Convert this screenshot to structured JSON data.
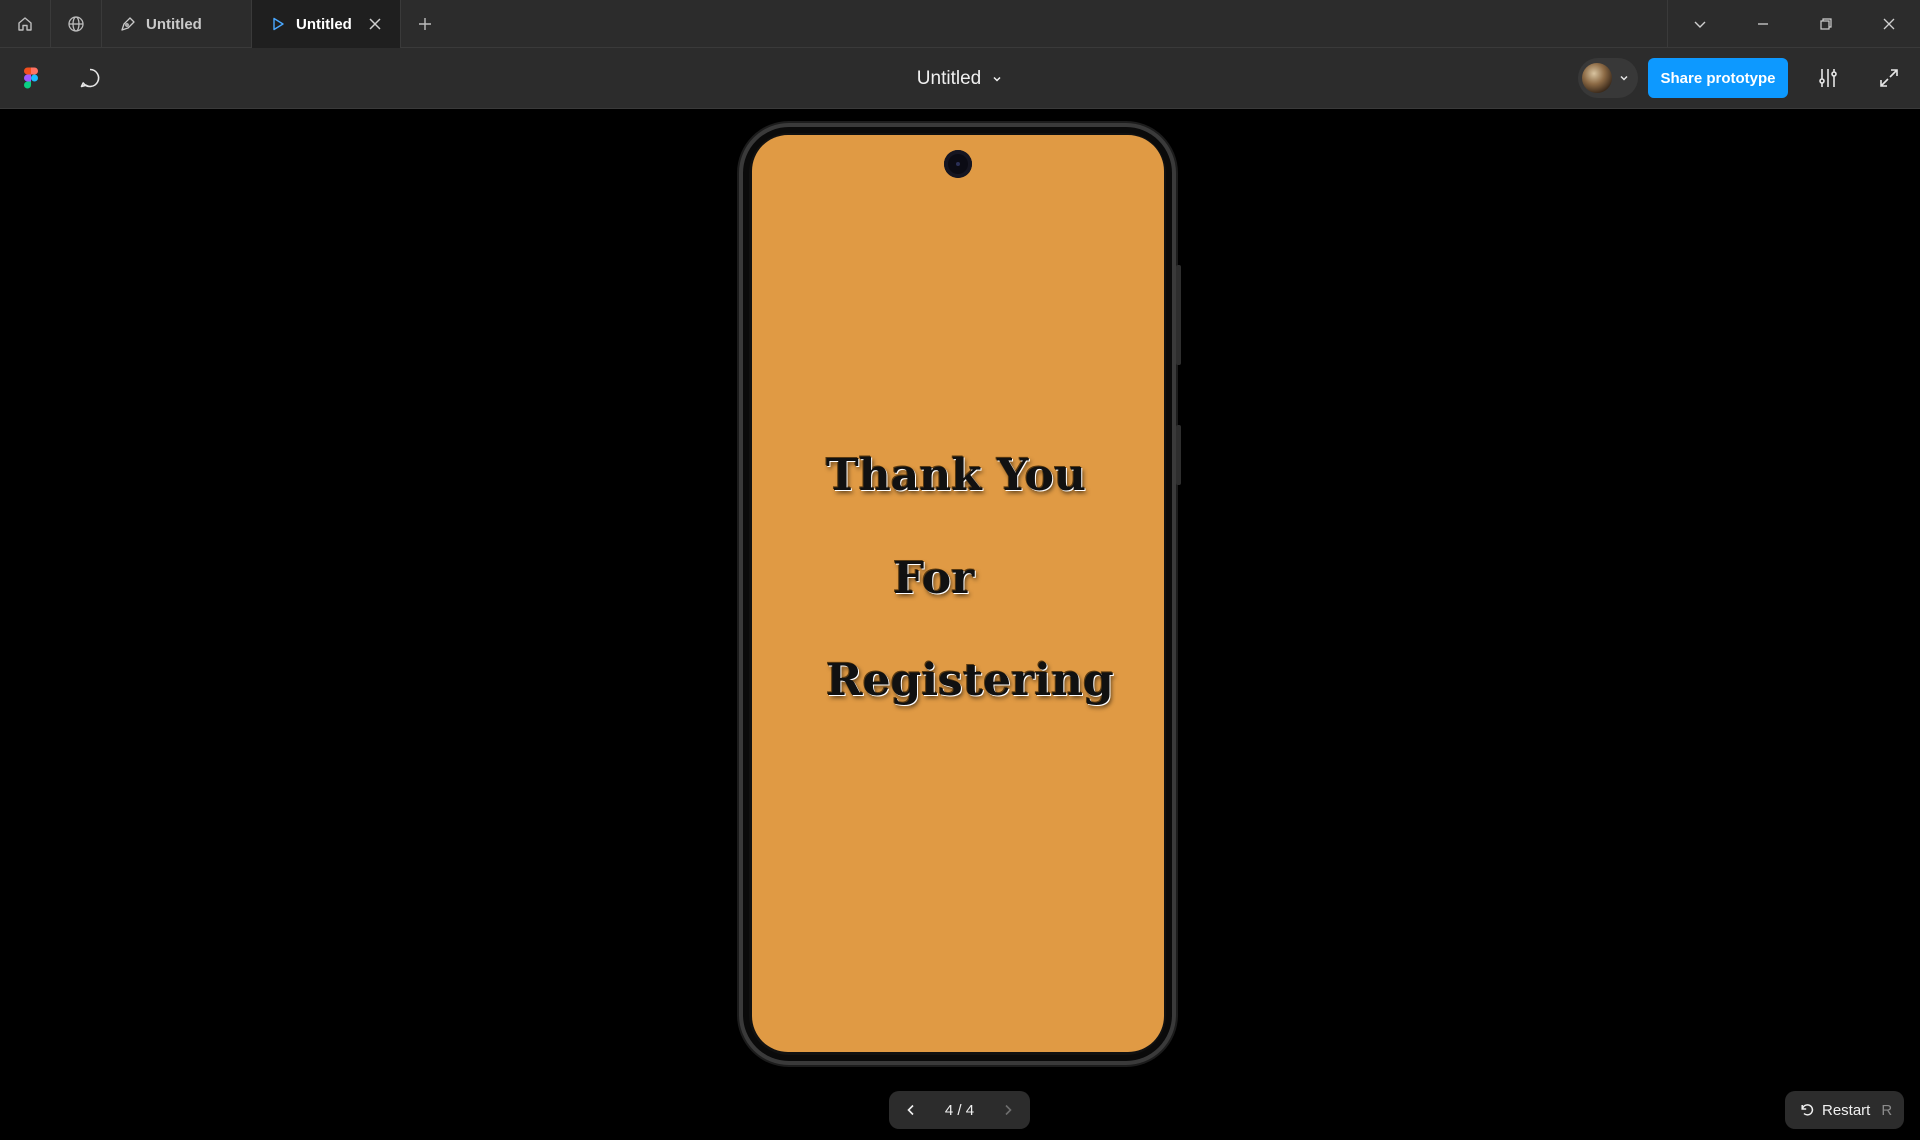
{
  "tabs": {
    "home_icon": "home-icon",
    "community_icon": "globe-icon",
    "items": [
      {
        "label": "Untitled",
        "icon": "pen-tool-icon",
        "active": false
      },
      {
        "label": "Untitled",
        "icon": "play-icon",
        "active": true
      }
    ],
    "new_tab_icon": "plus-icon"
  },
  "toolbar": {
    "document_title": "Untitled",
    "share_label": "Share prototype",
    "brand_color": "#0d99ff"
  },
  "prototype": {
    "screen_color": "#e09a44",
    "lines": [
      "Thank You",
      "For",
      "Registering"
    ]
  },
  "pager": {
    "label": "4 / 4"
  },
  "restart": {
    "label": "Restart",
    "shortcut": "R"
  }
}
